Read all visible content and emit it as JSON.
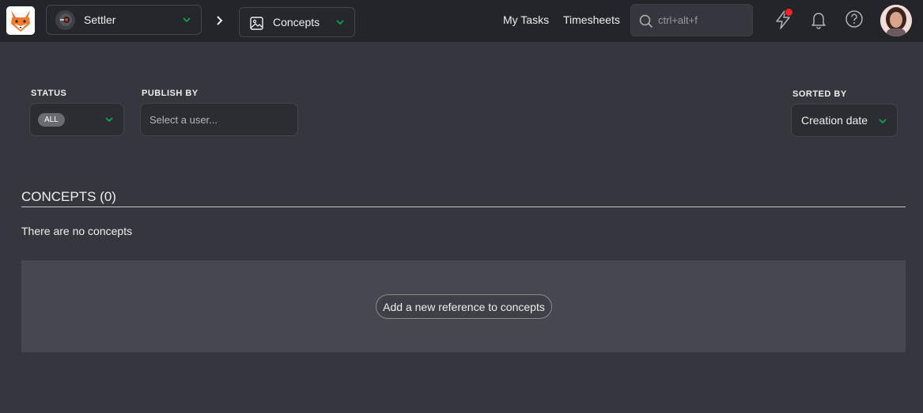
{
  "topbar": {
    "production": {
      "label": "Settler"
    },
    "section": {
      "label": "Concepts"
    },
    "nav": {
      "my_tasks": "My Tasks",
      "timesheets": "Timesheets"
    },
    "search": {
      "placeholder": "ctrl+alt+f"
    },
    "icons": [
      "kitsu-fox-logo",
      "lightning-icon",
      "bell-icon",
      "help-icon"
    ],
    "notification_dot_color": "#ff2020",
    "accent_color": "#00b242"
  },
  "filters": {
    "status": {
      "label": "STATUS",
      "value": "ALL"
    },
    "publish_by": {
      "label": "PUBLISH BY",
      "placeholder": "Select a user..."
    },
    "sorted_by": {
      "label": "SORTED BY",
      "value": "Creation date"
    }
  },
  "concepts": {
    "title": "CONCEPTS (0)",
    "empty_message": "There are no concepts",
    "add_button": "Add a new reference to concepts"
  }
}
